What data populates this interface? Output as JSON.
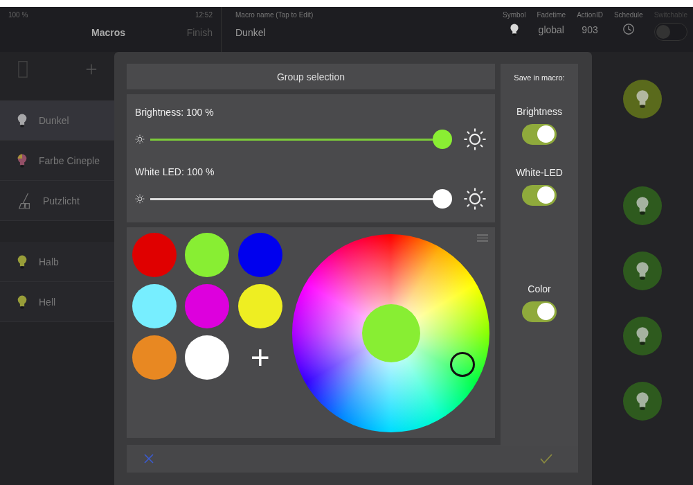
{
  "status": {
    "battery": "100 %",
    "time": "12:52"
  },
  "header": {
    "title": "Macros",
    "finish": "Finish",
    "macro_name_label": "Macro name (Tap to Edit)",
    "macro_name": "Dunkel",
    "fields": [
      {
        "kind": "icon",
        "label": "Symbol"
      },
      {
        "kind": "text",
        "label": "Fadetime",
        "value": "global"
      },
      {
        "kind": "text",
        "label": "ActionID",
        "value": "903"
      },
      {
        "kind": "clock",
        "label": "Schedule"
      },
      {
        "kind": "switch",
        "label": "Switchable",
        "on": false
      }
    ]
  },
  "macros": [
    {
      "name": "Dunkel",
      "kind": "white",
      "selected": true
    },
    {
      "name": "Farbe Cineple",
      "kind": "color",
      "selected": false
    },
    {
      "name": "Putzlicht",
      "kind": "broom",
      "selected": false
    },
    {
      "name": "Halb",
      "kind": "yellow",
      "selected": false
    },
    {
      "name": "Hell",
      "kind": "yellow",
      "selected": false
    }
  ],
  "dialog": {
    "title": "Group selection",
    "sliders": [
      {
        "label": "Brightness: 100 %",
        "level": 1,
        "kind": "green"
      },
      {
        "label": "White LED: 100 %",
        "level": 1,
        "kind": "white"
      }
    ],
    "swatches": [
      {
        "color": "#e00000"
      },
      {
        "color": "#88ee33"
      },
      {
        "color": "#0000ee"
      },
      {
        "color": "#77eeff"
      },
      {
        "color": "#dd00dd"
      },
      {
        "color": "#eeee22"
      },
      {
        "color": "#e88822"
      },
      {
        "color": "#ffffff"
      }
    ],
    "preview": {
      "color": "#88ee33"
    },
    "add_swatch": "+",
    "save_title": "Save in macro:",
    "save_options": [
      {
        "label": "Brightness",
        "on": true
      },
      {
        "label": "White-LED",
        "on": true
      },
      {
        "label": "Color",
        "on": true
      }
    ]
  }
}
